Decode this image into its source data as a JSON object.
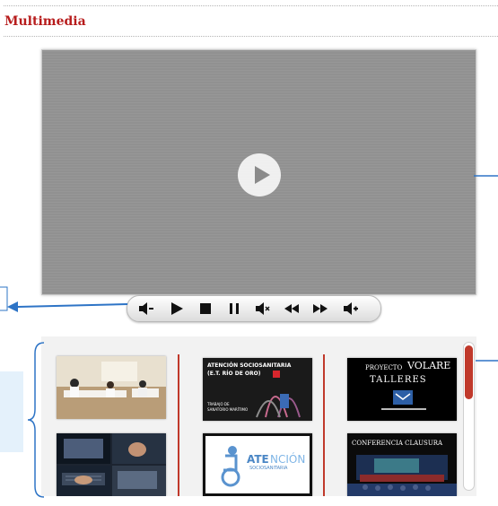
{
  "section": {
    "title": "Multimedia"
  },
  "player": {
    "play_overlay_icon": "play-circle-icon",
    "controls": [
      {
        "name": "volume-down-icon",
        "label": "Volume down"
      },
      {
        "name": "play-icon",
        "label": "Play"
      },
      {
        "name": "stop-icon",
        "label": "Stop"
      },
      {
        "name": "pause-icon",
        "label": "Pause"
      },
      {
        "name": "mute-icon",
        "label": "Mute"
      },
      {
        "name": "rewind-icon",
        "label": "Rewind"
      },
      {
        "name": "fast-forward-icon",
        "label": "Fast forward"
      },
      {
        "name": "volume-up-icon",
        "label": "Volume up"
      }
    ]
  },
  "gallery": {
    "thumbnails": [
      {
        "title_line1": "ATENCIÓN SOCIOSANITARIA",
        "title_line2": "(E.T. RÍO DE ORO)",
        "subtitle_line1": "TRABAJO DE",
        "subtitle_line2": "SANATORIO MARÍTIMO"
      },
      {
        "title_line1": "PROYECTO",
        "title_big": "VOLARE",
        "title_line2": "TALLERES"
      },
      {
        "title_prefix": "ATE",
        "title_suffix": "NCIÓN",
        "subtitle": "SOCIOSANITARIA"
      },
      {
        "title": "CONFERENCIA CLAUSURA"
      }
    ]
  },
  "colors": {
    "accent": "#c0392b",
    "title": "#b71c1c",
    "annotation": "#2e74c6"
  }
}
